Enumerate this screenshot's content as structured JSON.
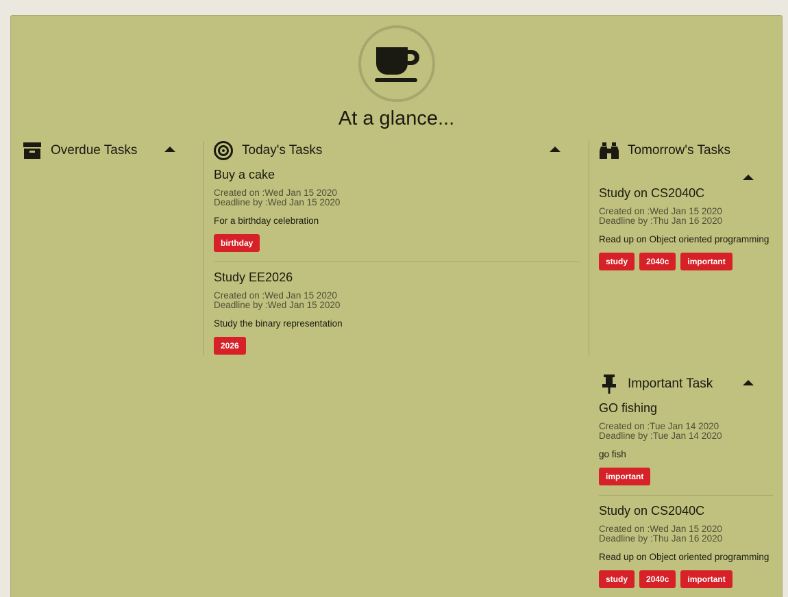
{
  "title": "At a glance...",
  "columns": {
    "overdue": {
      "label": "Overdue Tasks"
    },
    "today": {
      "label": "Today's Tasks"
    },
    "tomorrow": {
      "label": "Tomorrow's Tasks"
    },
    "important": {
      "label": "Important Task"
    }
  },
  "today_tasks": [
    {
      "title": "Buy a cake",
      "created": "Created on :Wed Jan 15 2020",
      "deadline": "Deadline by :Wed Jan 15 2020",
      "desc": "For a birthday celebration",
      "tags": [
        "birthday"
      ]
    },
    {
      "title": "Study EE2026",
      "created": "Created on :Wed Jan 15 2020",
      "deadline": "Deadline by :Wed Jan 15 2020",
      "desc": "Study the binary representation",
      "tags": [
        "2026"
      ]
    }
  ],
  "tomorrow_tasks": [
    {
      "title": "Study on CS2040C",
      "created": "Created on :Wed Jan 15 2020",
      "deadline": "Deadline by :Thu Jan 16 2020",
      "desc": "Read up on Object oriented programming",
      "tags": [
        "study",
        "2040c",
        "important"
      ]
    }
  ],
  "important_tasks": [
    {
      "title": "GO fishing",
      "created": "Created on :Tue Jan 14 2020",
      "deadline": "Deadline by :Tue Jan 14 2020",
      "desc": "go fish",
      "tags": [
        "important"
      ]
    },
    {
      "title": "Study on CS2040C",
      "created": "Created on :Wed Jan 15 2020",
      "deadline": "Deadline by :Thu Jan 16 2020",
      "desc": "Read up on Object oriented programming",
      "tags": [
        "study",
        "2040c",
        "important"
      ]
    }
  ],
  "icons": {
    "hero": "coffee-cup-icon",
    "overdue": "archive-box-icon",
    "today": "target-icon",
    "tomorrow": "binoculars-icon",
    "important": "pushpin-icon"
  },
  "colors": {
    "panel": "#c0c17e",
    "tag": "#d52127",
    "background": "#ebe8df"
  }
}
